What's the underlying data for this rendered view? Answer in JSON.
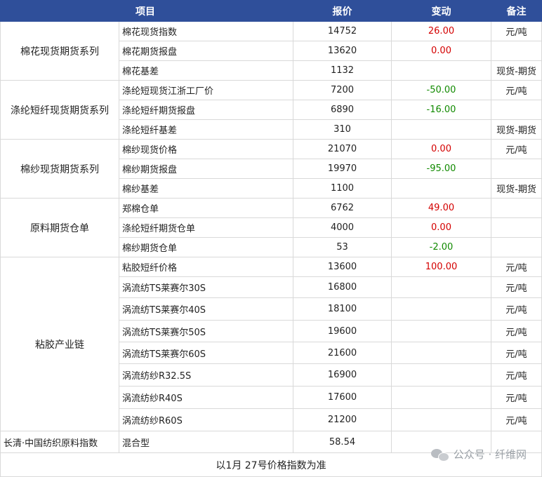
{
  "header": {
    "item": "项目",
    "price": "报价",
    "change": "变动",
    "note": "备注"
  },
  "groups": [
    {
      "name": "棉花现货期货系列",
      "rows": [
        {
          "item": "棉花现货指数",
          "price": "14752",
          "change": "26.00",
          "dir": "up",
          "note": "元/吨"
        },
        {
          "item": "棉花期货报盘",
          "price": "13620",
          "change": "0.00",
          "dir": "up",
          "note": ""
        },
        {
          "item": "棉花基差",
          "price": "1132",
          "change": "",
          "dir": "",
          "note": "现货-期货"
        }
      ]
    },
    {
      "name": "涤纶短纤现货期货系列",
      "rows": [
        {
          "item": "涤纶短现货江浙工厂价",
          "price": "7200",
          "change": "-50.00",
          "dir": "down",
          "note": "元/吨"
        },
        {
          "item": "涤纶短纤期货报盘",
          "price": "6890",
          "change": "-16.00",
          "dir": "down",
          "note": ""
        },
        {
          "item": "涤纶短纤基差",
          "price": "310",
          "change": "",
          "dir": "",
          "note": "现货-期货"
        }
      ]
    },
    {
      "name": "棉纱现货期货系列",
      "rows": [
        {
          "item": "棉纱现货价格",
          "price": "21070",
          "change": "0.00",
          "dir": "up",
          "note": "元/吨"
        },
        {
          "item": "棉纱期货报盘",
          "price": "19970",
          "change": "-95.00",
          "dir": "down",
          "note": ""
        },
        {
          "item": "棉纱基差",
          "price": "1100",
          "change": "",
          "dir": "",
          "note": "现货-期货"
        }
      ]
    },
    {
      "name": "原料期货仓单",
      "rows": [
        {
          "item": "郑棉仓单",
          "price": "6762",
          "change": "49.00",
          "dir": "up",
          "note": ""
        },
        {
          "item": "涤纶短纤期货仓单",
          "price": "4000",
          "change": "0.00",
          "dir": "up",
          "note": ""
        },
        {
          "item": "棉纱期货仓单",
          "price": "53",
          "change": "-2.00",
          "dir": "down",
          "note": ""
        }
      ]
    },
    {
      "name": "粘胶产业链",
      "rows": [
        {
          "item": "粘胶短纤价格",
          "price": "13600",
          "change": "100.00",
          "dir": "up",
          "note": "元/吨"
        },
        {
          "item": "涡流纺TS莱赛尔30S",
          "price": "16800",
          "change": "",
          "dir": "",
          "note": "元/吨"
        },
        {
          "item": "涡流纺TS莱赛尔40S",
          "price": "18100",
          "change": "",
          "dir": "",
          "note": "元/吨"
        },
        {
          "item": "涡流纺TS莱赛尔50S",
          "price": "19600",
          "change": "",
          "dir": "",
          "note": "元/吨"
        },
        {
          "item": "涡流纺TS莱赛尔60S",
          "price": "21600",
          "change": "",
          "dir": "",
          "note": "元/吨"
        },
        {
          "item": "涡流纺纱R32.5S",
          "price": "16900",
          "change": "",
          "dir": "",
          "note": "元/吨"
        },
        {
          "item": "涡流纺纱R40S",
          "price": "17600",
          "change": "",
          "dir": "",
          "note": "元/吨"
        },
        {
          "item": "涡流纺纱R60S",
          "price": "21200",
          "change": "",
          "dir": "",
          "note": "元/吨"
        }
      ]
    }
  ],
  "index_row": {
    "label": "长清·中国纺织原料指数",
    "type": "混合型",
    "value": "58.54"
  },
  "footer_note": "以1月 27号价格指数为准",
  "watermark": {
    "text": "公众号 · 纤维网",
    "icon": "wechat-icon"
  },
  "colors": {
    "header_bg": "#2f4f9a",
    "up": "#d40000",
    "down": "#118a00"
  }
}
